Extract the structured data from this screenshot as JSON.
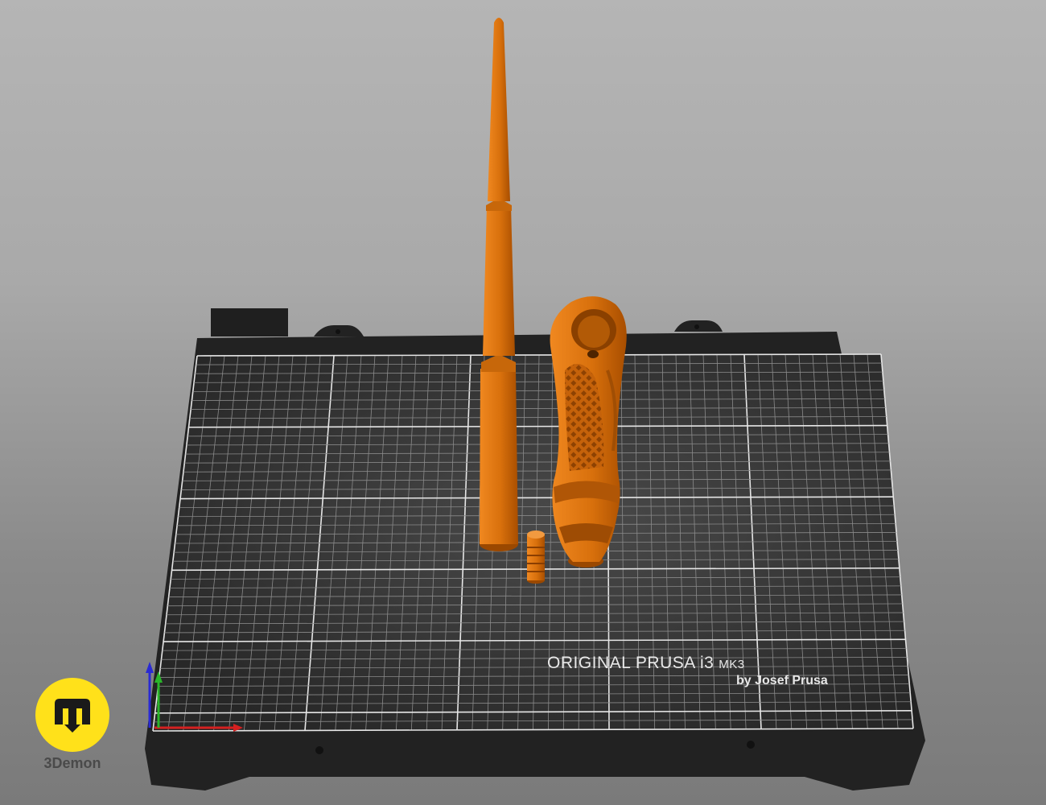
{
  "bed": {
    "brand_line": "ORIGINAL PRUSA i3",
    "model_suffix": "MK3",
    "maker_line": "by Josef Prusa"
  },
  "watermark": {
    "name": "3Demon",
    "badge_color": "#ffe11a"
  },
  "colors": {
    "model_orange": "#e07a10",
    "bed_dark": "#2c2c2c",
    "frame_black": "#1e1e1e",
    "axis_x": "#d42020",
    "axis_y": "#2ab52a",
    "axis_z": "#2a2ad4"
  },
  "objects": [
    {
      "id": "wand-shaft",
      "icon": "tapered-shaft"
    },
    {
      "id": "wand-handle",
      "icon": "ornate-handle"
    },
    {
      "id": "small-connector",
      "icon": "cylinder-pin"
    }
  ]
}
